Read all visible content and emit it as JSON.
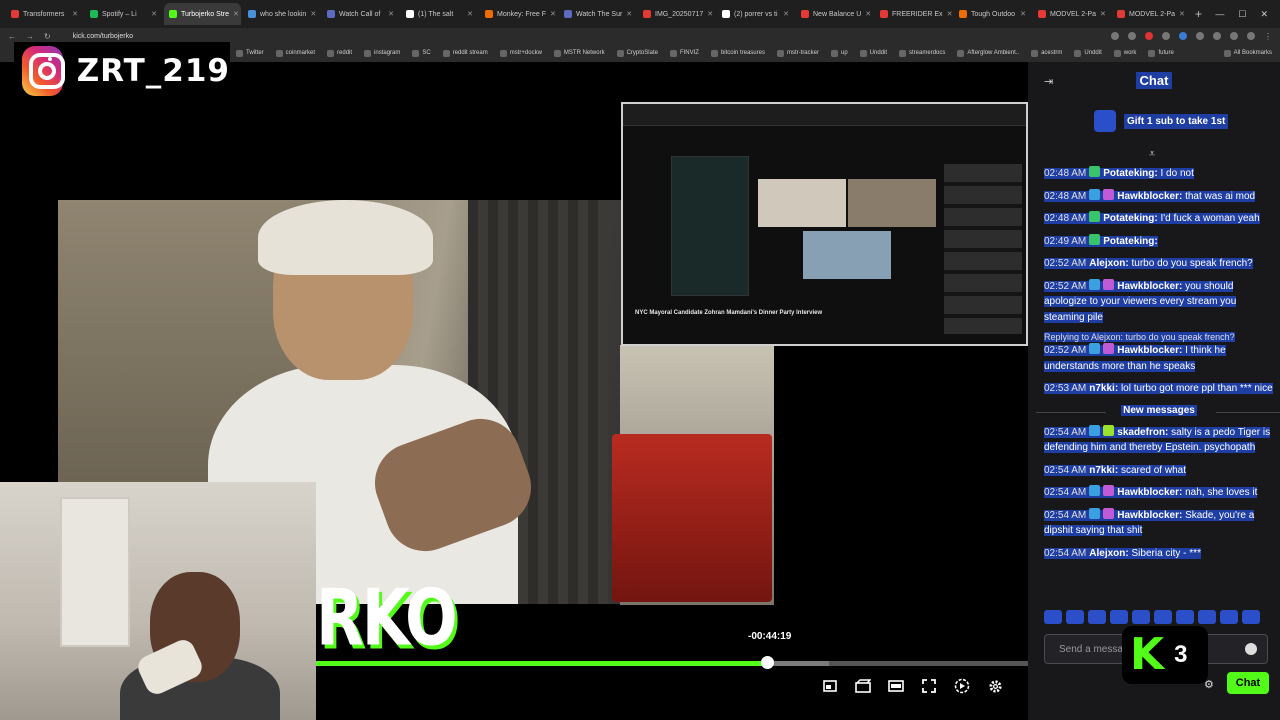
{
  "browser": {
    "tabs": [
      {
        "label": "Transformers ",
        "color": "#e53935"
      },
      {
        "label": "Spotify – Li",
        "color": "#1db954"
      },
      {
        "label": "Turbojerko Stre",
        "color": "#53fc18",
        "active": true
      },
      {
        "label": "who she lookin",
        "color": "#4a90d9"
      },
      {
        "label": "Watch Call of",
        "color": "#5c6bc0"
      },
      {
        "label": "(1) The salt",
        "color": "#ffffff"
      },
      {
        "label": "Monkey: Free F",
        "color": "#ef6c00"
      },
      {
        "label": "Watch The Sur",
        "color": "#5c6bc0"
      },
      {
        "label": "IMG_20250717",
        "color": "#e53935"
      },
      {
        "label": "(2) porrer vs ti",
        "color": "#ffffff"
      },
      {
        "label": "New Balance U",
        "color": "#e53935"
      },
      {
        "label": "FREERIDER Ex",
        "color": "#e53935"
      },
      {
        "label": "Tough Outdoo",
        "color": "#ef6c00"
      },
      {
        "label": "MODVEL 2-Pa",
        "color": "#e53935"
      },
      {
        "label": "MODVEL 2-Pa",
        "color": "#e53935"
      }
    ],
    "url": "kick.com/turbojerko",
    "bookmarks": [
      "Twitter",
      "coinmarket",
      "reddit",
      "instagram",
      "SC",
      "reddit stream",
      "mstr+dockw",
      "MSTR Network",
      "CryptoSlate",
      "FINVIZ",
      "bitcoin treasures",
      "mstr-tracker",
      "up",
      "Unddit",
      "streamerdocs",
      "Afterglow Ambient..",
      "acestrm",
      "Unddit",
      "work",
      "future"
    ],
    "all_bookmarks": "All Bookmarks"
  },
  "overlay": {
    "instagram_handle": "ZRT_219",
    "stream_logo_text": "RKO",
    "kick_count": "3"
  },
  "screen_share": {
    "caption": "NYC Mayoral Candidate Zohran Mamdani's Dinner Party Interview"
  },
  "player": {
    "time_remaining": "-00:44:19",
    "progress_fraction": 0.634,
    "buffered_fraction": 0.72,
    "controls": [
      "miniplayer-icon",
      "clip-icon",
      "theater-icon",
      "fullscreen-icon",
      "speed-icon",
      "settings-icon"
    ]
  },
  "chat": {
    "title": "Chat",
    "gift_label": "Gift 1 sub to take 1st",
    "messages_before": [
      {
        "time": "02:48 AM",
        "user": "Potateking:",
        "text": " I do not",
        "badges": [
          "#39c46b"
        ]
      },
      {
        "time": "02:48 AM",
        "user": "Hawkblocker:",
        "text": " that was ai mod",
        "badges": [
          "#3aa0e0",
          "#c15ad6"
        ]
      },
      {
        "time": "02:48 AM",
        "user": "Potateking:",
        "text": " I'd fuck a woman yeah",
        "badges": [
          "#39c46b"
        ]
      },
      {
        "time": "02:49 AM",
        "user": "Potateking:",
        "text": " ",
        "badges": [
          "#39c46b"
        ]
      },
      {
        "time": "02:52 AM",
        "user": "Alejxon:",
        "text": " turbo do you speak french?",
        "badges": []
      },
      {
        "time": "02:52 AM",
        "user": "Hawkblocker:",
        "text": " you should apologize to your viewers every stream you steaming pile",
        "badges": [
          "#3aa0e0",
          "#c15ad6"
        ]
      }
    ],
    "reply_context": "Replying to Alejxon: turbo do you speak french?",
    "reply_message": {
      "time": "02:52 AM",
      "user": "Hawkblocker:",
      "text": " I think he understands more than he speaks",
      "badges": [
        "#3aa0e0",
        "#c15ad6"
      ]
    },
    "message_after_reply": {
      "time": "02:53 AM",
      "user": "n7kki:",
      "text": " lol turbo got more ppl than *** nice",
      "badges": []
    },
    "new_messages_label": "New messages",
    "messages_after": [
      {
        "time": "02:54 AM",
        "user": "skadefron:",
        "text": " salty is a pedo Tiger is defending him and thereby Epstein. psychopath",
        "badges": [
          "#3aa0e0",
          "#9be22d"
        ]
      },
      {
        "time": "02:54 AM",
        "user": "n7kki:",
        "text": " scared of what",
        "badges": []
      },
      {
        "time": "02:54 AM",
        "user": "Hawkblocker:",
        "text": " nah, she loves it",
        "badges": [
          "#3aa0e0",
          "#c15ad6"
        ]
      },
      {
        "time": "02:54 AM",
        "user": "Hawkblocker:",
        "text": " Skade, you're a dipshit saying that shit",
        "badges": [
          "#3aa0e0",
          "#c15ad6"
        ]
      },
      {
        "time": "02:54 AM",
        "user": "Alejxon:",
        "text": " Siberia city - ***",
        "badges": []
      }
    ],
    "input_placeholder": "Send a message",
    "send_label": "Chat"
  }
}
